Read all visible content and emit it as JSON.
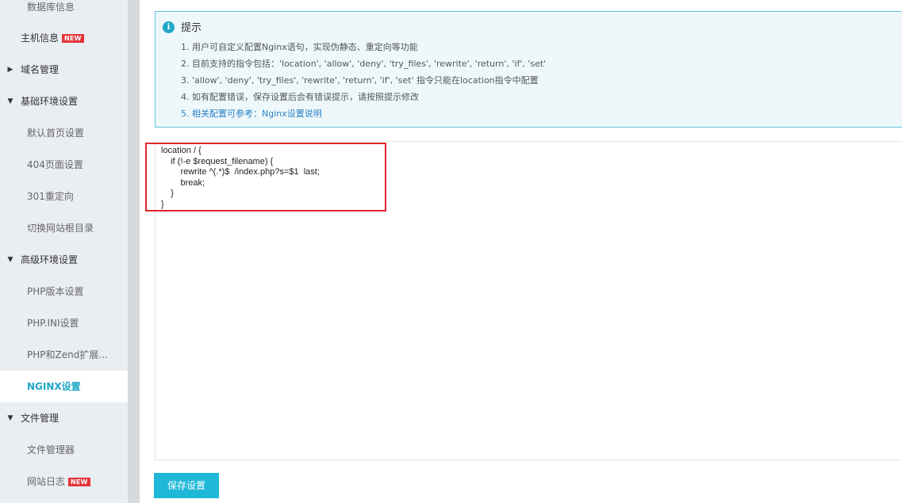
{
  "sidebar": {
    "db_info": "数据库信息",
    "host_info": "主机信息",
    "new_badge": "NEW",
    "domain_mgmt": "域名管理",
    "basic_env": "基础环境设置",
    "default_index": "默认首页设置",
    "page_404": "404页面设置",
    "redirect_301": "301重定向",
    "switch_root": "切换网站根目录",
    "advanced_env": "高级环境设置",
    "php_version": "PHP版本设置",
    "php_ini": "PHP.INI设置",
    "php_zend": "PHP和Zend扩展...",
    "nginx": "NGINX设置",
    "file_mgmt": "文件管理",
    "file_manager": "文件管理器",
    "site_log": "网站日志",
    "site_log_badge": "NEW"
  },
  "tip": {
    "title": "提示",
    "line1": "1. 用户可自定义配置Nginx语句，实现伪静态、重定向等功能",
    "line2": "2. 目前支持的指令包括：'location', 'allow', 'deny', 'try_files', 'rewrite', 'return', 'if', 'set'",
    "line3": "3. 'allow', 'deny', 'try_files', 'rewrite', 'return', 'if', 'set' 指令只能在location指令中配置",
    "line4": "4. 如有配置错误，保存设置后会有错误提示，请按照提示修改",
    "line5_prefix": "5. 相关配置可参考：",
    "line5_link": "Nginx设置说明"
  },
  "editor": {
    "code": "location / {\n    if (!-e $request_filename) {\n        rewrite ^(.*)$  /index.php?s=$1  last;\n        break;\n    }\n}"
  },
  "actions": {
    "save_label": "保存设置"
  },
  "colors": {
    "accent": "#1fb8d8",
    "active_text": "#20a8c8",
    "badge": "#e3353b",
    "highlight": "#e0252a"
  }
}
